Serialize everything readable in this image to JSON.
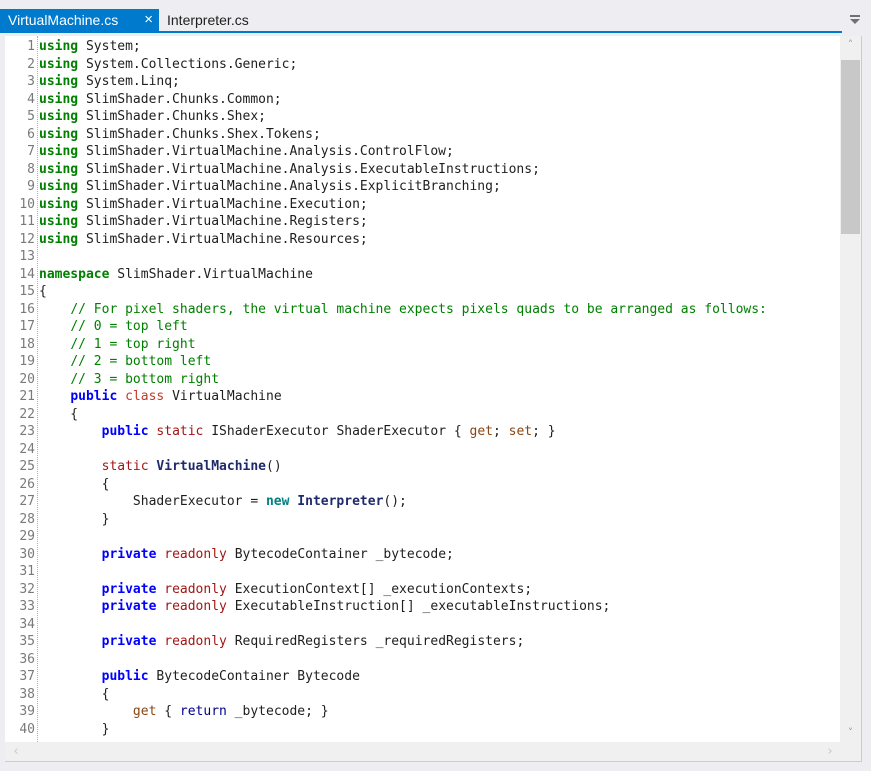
{
  "tabs": [
    {
      "label": "VirtualMachine.cs",
      "active": true,
      "close_icon": "×"
    },
    {
      "label": "Interpreter.cs",
      "active": false
    }
  ],
  "menu_icon": "tab-list-dropdown-icon",
  "colors": {
    "accent": "#007acc",
    "using_kw": "#008000",
    "keyword": "#0000ff",
    "modifier": "#a31515",
    "comment": "#008000"
  },
  "scrollbar": {
    "up": "^",
    "down": "v",
    "left": "<",
    "right": ">",
    "vertical_position": 0.0
  },
  "lines": [
    {
      "n": "1",
      "segs": [
        [
          "using",
          "kw-using"
        ],
        [
          " System;",
          ""
        ]
      ]
    },
    {
      "n": "2",
      "segs": [
        [
          "using",
          "kw-using"
        ],
        [
          " System.Collections.Generic;",
          ""
        ]
      ]
    },
    {
      "n": "3",
      "segs": [
        [
          "using",
          "kw-using"
        ],
        [
          " System.Linq;",
          ""
        ]
      ]
    },
    {
      "n": "4",
      "segs": [
        [
          "using",
          "kw-using"
        ],
        [
          " SlimShader.Chunks.Common;",
          ""
        ]
      ]
    },
    {
      "n": "5",
      "segs": [
        [
          "using",
          "kw-using"
        ],
        [
          " SlimShader.Chunks.Shex;",
          ""
        ]
      ]
    },
    {
      "n": "6",
      "segs": [
        [
          "using",
          "kw-using"
        ],
        [
          " SlimShader.Chunks.Shex.Tokens;",
          ""
        ]
      ]
    },
    {
      "n": "7",
      "segs": [
        [
          "using",
          "kw-using"
        ],
        [
          " SlimShader.VirtualMachine.Analysis.ControlFlow;",
          ""
        ]
      ]
    },
    {
      "n": "8",
      "segs": [
        [
          "using",
          "kw-using"
        ],
        [
          " SlimShader.VirtualMachine.Analysis.ExecutableInstructions;",
          ""
        ]
      ]
    },
    {
      "n": "9",
      "segs": [
        [
          "using",
          "kw-using"
        ],
        [
          " SlimShader.VirtualMachine.Analysis.ExplicitBranching;",
          ""
        ]
      ]
    },
    {
      "n": "10",
      "segs": [
        [
          "using",
          "kw-using"
        ],
        [
          " SlimShader.VirtualMachine.Execution;",
          ""
        ]
      ]
    },
    {
      "n": "11",
      "segs": [
        [
          "using",
          "kw-using"
        ],
        [
          " SlimShader.VirtualMachine.Registers;",
          ""
        ]
      ]
    },
    {
      "n": "12",
      "segs": [
        [
          "using",
          "kw-using"
        ],
        [
          " SlimShader.VirtualMachine.Resources;",
          ""
        ]
      ]
    },
    {
      "n": "13",
      "segs": []
    },
    {
      "n": "14",
      "segs": [
        [
          "namespace",
          "kw-using"
        ],
        [
          " SlimShader.VirtualMachine",
          ""
        ]
      ]
    },
    {
      "n": "15",
      "segs": [
        [
          "{",
          ""
        ]
      ]
    },
    {
      "n": "16",
      "segs": [
        [
          "    ",
          ""
        ],
        [
          "// For pixel shaders, the virtual machine expects pixels quads to be arranged as follows:",
          "comment"
        ]
      ]
    },
    {
      "n": "17",
      "segs": [
        [
          "    ",
          ""
        ],
        [
          "// 0 = top left",
          "comment"
        ]
      ]
    },
    {
      "n": "18",
      "segs": [
        [
          "    ",
          ""
        ],
        [
          "// 1 = top right",
          "comment"
        ]
      ]
    },
    {
      "n": "19",
      "segs": [
        [
          "    ",
          ""
        ],
        [
          "// 2 = bottom left",
          "comment"
        ]
      ]
    },
    {
      "n": "20",
      "segs": [
        [
          "    ",
          ""
        ],
        [
          "// 3 = bottom right",
          "comment"
        ]
      ]
    },
    {
      "n": "21",
      "segs": [
        [
          "    ",
          ""
        ],
        [
          "public",
          "kw-blue"
        ],
        [
          " ",
          ""
        ],
        [
          "class",
          "kw-red"
        ],
        [
          " VirtualMachine",
          ""
        ]
      ]
    },
    {
      "n": "22",
      "segs": [
        [
          "    {",
          ""
        ]
      ]
    },
    {
      "n": "23",
      "segs": [
        [
          "        ",
          ""
        ],
        [
          "public",
          "kw-blue"
        ],
        [
          " ",
          ""
        ],
        [
          "static",
          "kw-red2"
        ],
        [
          " IShaderExecutor ShaderExecutor { ",
          ""
        ],
        [
          "get",
          "getset"
        ],
        [
          "; ",
          ""
        ],
        [
          "set",
          "getset"
        ],
        [
          "; }",
          ""
        ]
      ]
    },
    {
      "n": "24",
      "segs": []
    },
    {
      "n": "25",
      "segs": [
        [
          "        ",
          ""
        ],
        [
          "static",
          "kw-red2"
        ],
        [
          " ",
          ""
        ],
        [
          "VirtualMachine",
          "type-bold"
        ],
        [
          "()",
          ""
        ]
      ]
    },
    {
      "n": "26",
      "segs": [
        [
          "        {",
          ""
        ]
      ]
    },
    {
      "n": "27",
      "segs": [
        [
          "            ShaderExecutor = ",
          ""
        ],
        [
          "new",
          "kw-teal"
        ],
        [
          " ",
          ""
        ],
        [
          "Interpreter",
          "type-bold"
        ],
        [
          "();",
          ""
        ]
      ]
    },
    {
      "n": "28",
      "segs": [
        [
          "        }",
          ""
        ]
      ]
    },
    {
      "n": "29",
      "segs": []
    },
    {
      "n": "30",
      "segs": [
        [
          "        ",
          ""
        ],
        [
          "private",
          "kw-blue"
        ],
        [
          " ",
          ""
        ],
        [
          "readonly",
          "kw-red2"
        ],
        [
          " BytecodeContainer _bytecode;",
          ""
        ]
      ]
    },
    {
      "n": "31",
      "segs": []
    },
    {
      "n": "32",
      "segs": [
        [
          "        ",
          ""
        ],
        [
          "private",
          "kw-blue"
        ],
        [
          " ",
          ""
        ],
        [
          "readonly",
          "kw-red2"
        ],
        [
          " ExecutionContext[] _executionContexts;",
          ""
        ]
      ]
    },
    {
      "n": "33",
      "segs": [
        [
          "        ",
          ""
        ],
        [
          "private",
          "kw-blue"
        ],
        [
          " ",
          ""
        ],
        [
          "readonly",
          "kw-red2"
        ],
        [
          " ExecutableInstruction[] _executableInstructions;",
          ""
        ]
      ]
    },
    {
      "n": "34",
      "segs": []
    },
    {
      "n": "35",
      "segs": [
        [
          "        ",
          ""
        ],
        [
          "private",
          "kw-blue"
        ],
        [
          " ",
          ""
        ],
        [
          "readonly",
          "kw-red2"
        ],
        [
          " RequiredRegisters _requiredRegisters;",
          ""
        ]
      ]
    },
    {
      "n": "36",
      "segs": []
    },
    {
      "n": "37",
      "segs": [
        [
          "        ",
          ""
        ],
        [
          "public",
          "kw-blue"
        ],
        [
          " BytecodeContainer Bytecode",
          ""
        ]
      ]
    },
    {
      "n": "38",
      "segs": [
        [
          "        {",
          ""
        ]
      ]
    },
    {
      "n": "39",
      "segs": [
        [
          "            ",
          ""
        ],
        [
          "get",
          "getset"
        ],
        [
          " { ",
          ""
        ],
        [
          "return",
          "ret"
        ],
        [
          " _bytecode; }",
          ""
        ]
      ]
    },
    {
      "n": "40",
      "segs": [
        [
          "        }",
          ""
        ]
      ]
    }
  ]
}
